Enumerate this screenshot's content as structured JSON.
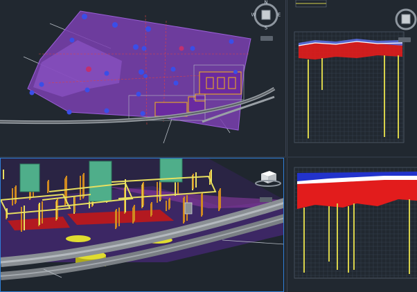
{
  "viewcube": {
    "north": "N",
    "south": "S",
    "east": "E",
    "west": "W"
  },
  "viewports": {
    "plan": {
      "name": "plan-view"
    },
    "model_3d": {
      "name": "3d-model-view"
    },
    "section_top": {
      "name": "borehole-section-top"
    },
    "section_bottom": {
      "name": "borehole-section-bottom"
    }
  },
  "colors": {
    "background": "#212830",
    "site_fill": "#7a3fb0",
    "active_border": "#2f7fd8",
    "stratum_red": "#e21c1c",
    "stratum_blue": "#2233cc",
    "pile_yellow": "#d8d24a",
    "building_green": "#4fae8a",
    "pipe_grey": "#8a8f94"
  }
}
